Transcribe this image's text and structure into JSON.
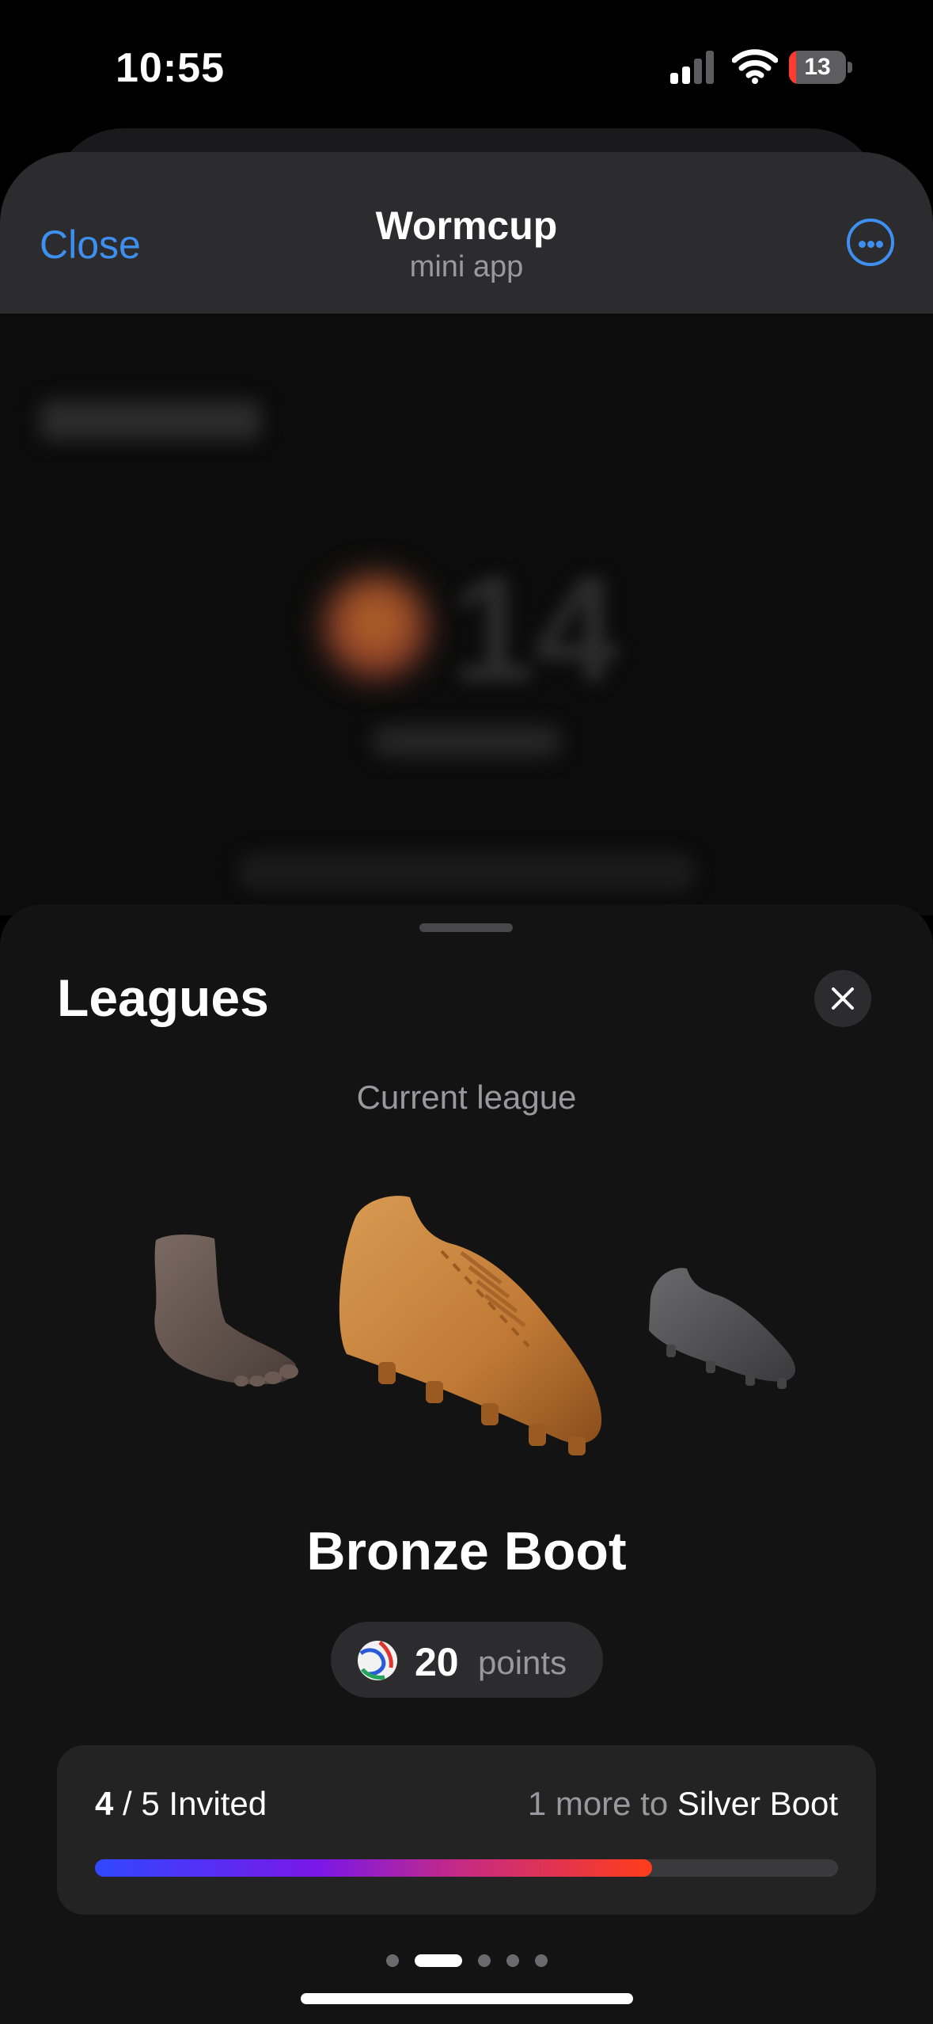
{
  "status_bar": {
    "time": "10:55",
    "battery_level": "13",
    "battery_fraction": 0.13
  },
  "header": {
    "close_label": "Close",
    "title": "Wormcup",
    "subtitle": "mini app"
  },
  "sheet": {
    "title": "Leagues",
    "current_label": "Current league",
    "league_name": "Bronze Boot",
    "points": {
      "value": "20",
      "label": "points"
    },
    "invite": {
      "current": "4",
      "separator": " / ",
      "total": "5",
      "invited_label": " Invited",
      "more_prefix": "1 more to ",
      "next_league": "Silver Boot",
      "progress_fraction": 0.75
    },
    "pagination": {
      "count": 5,
      "active_index": 1
    }
  },
  "colors": {
    "accent": "#3e8ff0",
    "bronze": "#c98a45",
    "silver": "#5a5a5c",
    "progress_start": "#3048ff",
    "progress_end": "#ff3d1a"
  },
  "icons": [
    "signal-icon",
    "wifi-icon",
    "battery-icon",
    "more-icon",
    "close-icon",
    "foot-icon",
    "bronze-boot-icon",
    "silver-boot-icon",
    "ball-icon"
  ]
}
